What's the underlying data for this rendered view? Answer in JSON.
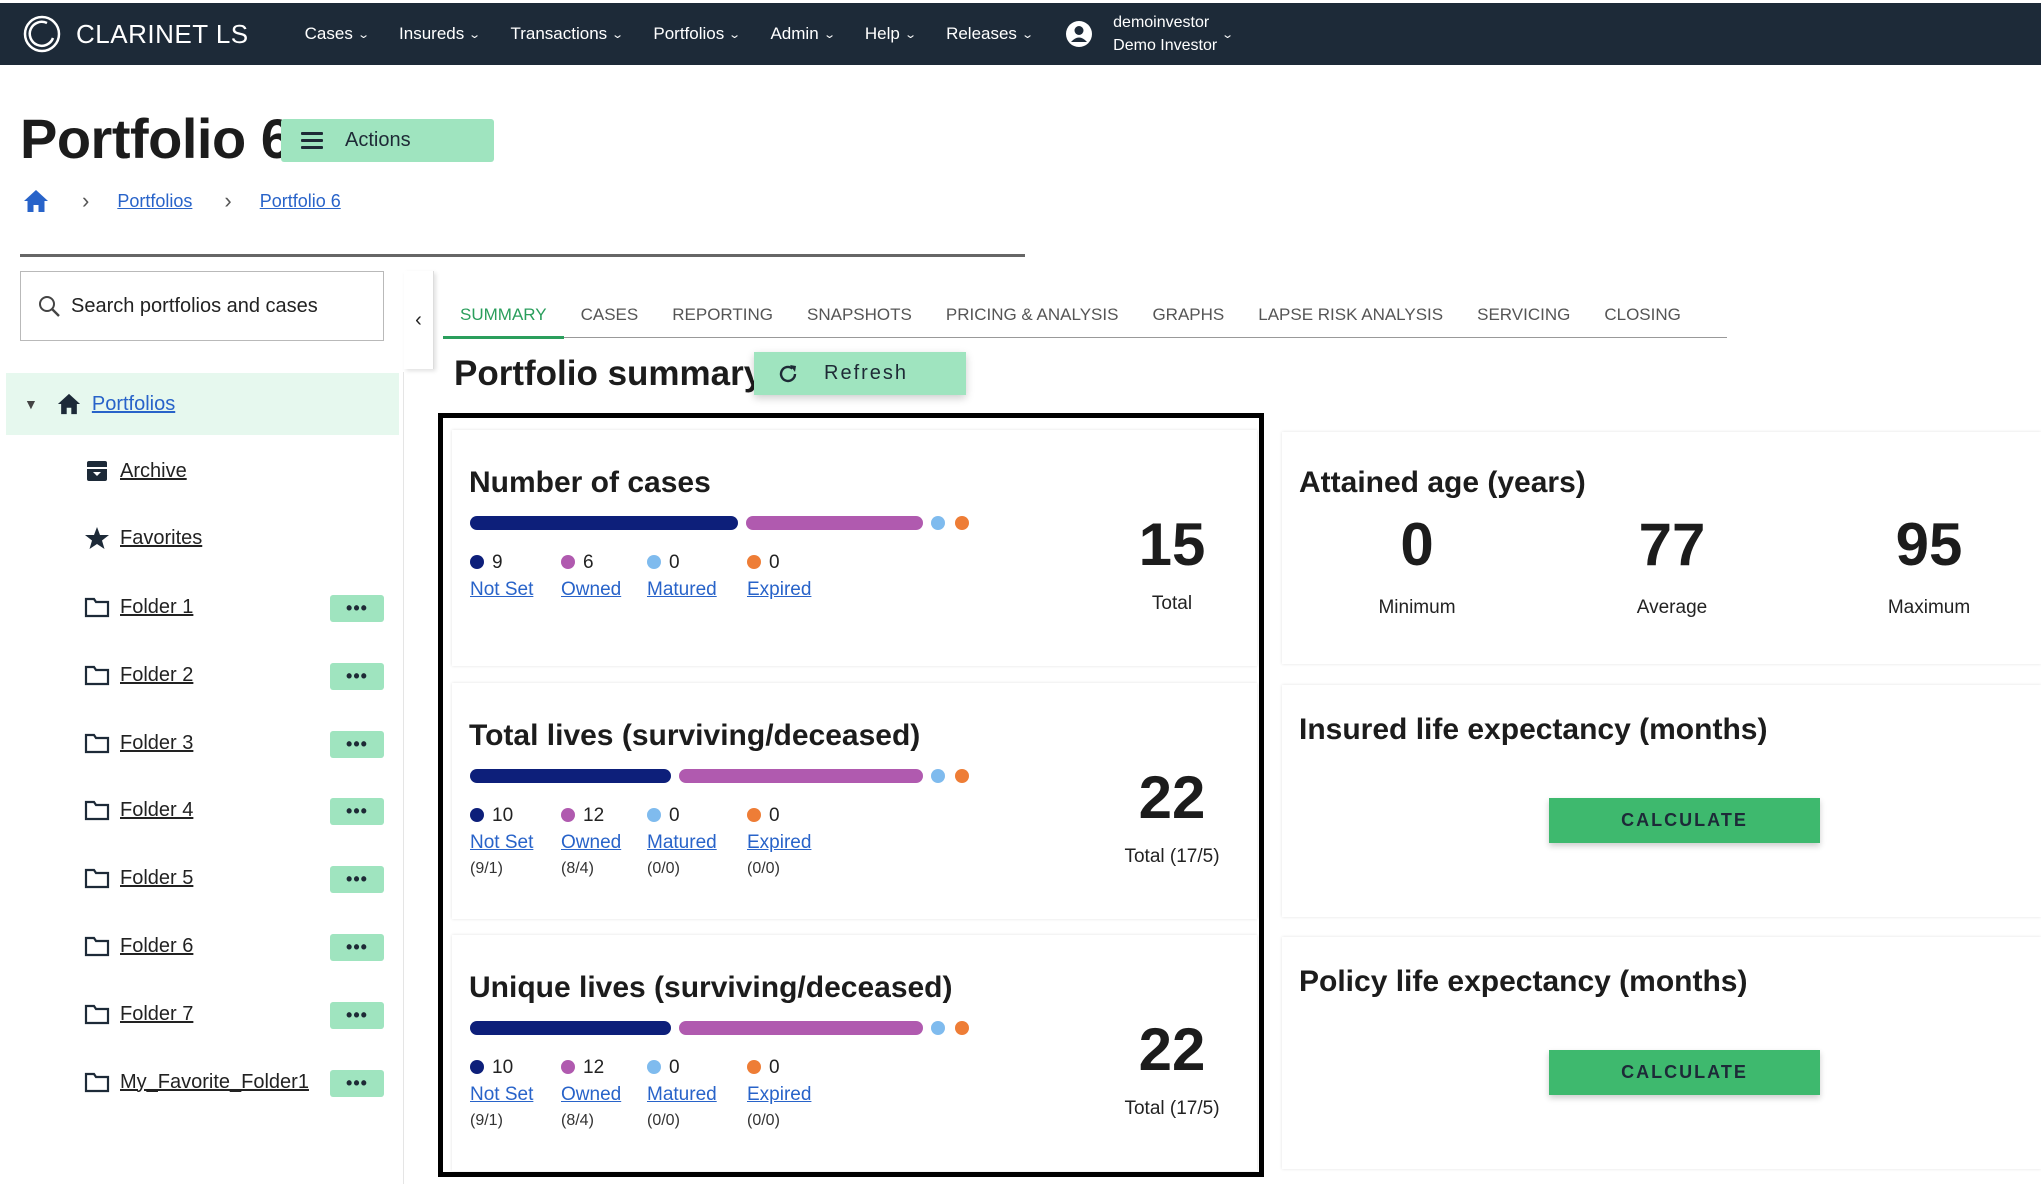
{
  "app": {
    "brand": "CLARINET LS"
  },
  "nav": {
    "items": [
      {
        "label": "Cases"
      },
      {
        "label": "Insureds"
      },
      {
        "label": "Transactions"
      },
      {
        "label": "Portfolios"
      },
      {
        "label": "Admin"
      },
      {
        "label": "Help"
      },
      {
        "label": "Releases"
      }
    ],
    "user": {
      "username": "demoinvestor",
      "display_name": "Demo Investor"
    }
  },
  "page": {
    "title": "Portfolio 6",
    "actions_label": "Actions"
  },
  "breadcrumb": {
    "items": [
      {
        "label": "Portfolios"
      },
      {
        "label": "Portfolio 6"
      }
    ]
  },
  "sidebar": {
    "search_placeholder": "Search portfolios and cases",
    "root": {
      "label": "Portfolios"
    },
    "items": [
      {
        "label": "Archive",
        "icon": "archive-icon"
      },
      {
        "label": "Favorites",
        "icon": "star-icon"
      },
      {
        "label": "Folder 1",
        "icon": "folder-icon",
        "more": "•••"
      },
      {
        "label": "Folder 2",
        "icon": "folder-icon",
        "more": "•••"
      },
      {
        "label": "Folder 3",
        "icon": "folder-icon",
        "more": "•••"
      },
      {
        "label": "Folder 4",
        "icon": "folder-icon",
        "more": "•••"
      },
      {
        "label": "Folder 5",
        "icon": "folder-icon",
        "more": "•••"
      },
      {
        "label": "Folder 6",
        "icon": "folder-icon",
        "more": "•••"
      },
      {
        "label": "Folder 7",
        "icon": "folder-icon",
        "more": "•••"
      },
      {
        "label": "My_Favorite_Folder1",
        "icon": "folder-icon",
        "more": "•••"
      }
    ]
  },
  "tabs": {
    "items": [
      {
        "label": "SUMMARY",
        "active": true
      },
      {
        "label": "CASES"
      },
      {
        "label": "REPORTING"
      },
      {
        "label": "SNAPSHOTS"
      },
      {
        "label": "PRICING & ANALYSIS"
      },
      {
        "label": "GRAPHS"
      },
      {
        "label": "LAPSE RISK ANALYSIS"
      },
      {
        "label": "SERVICING"
      },
      {
        "label": "CLOSING"
      }
    ]
  },
  "summary": {
    "title": "Portfolio summary",
    "refresh_label": "Refresh",
    "colors": {
      "not_set": "#0d1f7a",
      "owned": "#b05aaf",
      "matured": "#7fbbee",
      "expired": "#ee7d36"
    },
    "cases": {
      "title": "Number of cases",
      "legend": [
        {
          "count": "9",
          "label": "Not Set"
        },
        {
          "count": "6",
          "label": "Owned"
        },
        {
          "count": "0",
          "label": "Matured"
        },
        {
          "count": "0",
          "label": "Expired"
        }
      ],
      "total": "15",
      "total_label": "Total"
    },
    "total_lives": {
      "title": "Total lives (surviving/deceased)",
      "legend": [
        {
          "count": "10",
          "label": "Not Set",
          "sub": "(9/1)"
        },
        {
          "count": "12",
          "label": "Owned",
          "sub": "(8/4)"
        },
        {
          "count": "0",
          "label": "Matured",
          "sub": "(0/0)"
        },
        {
          "count": "0",
          "label": "Expired",
          "sub": "(0/0)"
        }
      ],
      "total": "22",
      "total_label": "Total (17/5)"
    },
    "unique_lives": {
      "title": "Unique lives (surviving/deceased)",
      "legend": [
        {
          "count": "10",
          "label": "Not Set",
          "sub": "(9/1)"
        },
        {
          "count": "12",
          "label": "Owned",
          "sub": "(8/4)"
        },
        {
          "count": "0",
          "label": "Matured",
          "sub": "(0/0)"
        },
        {
          "count": "0",
          "label": "Expired",
          "sub": "(0/0)"
        }
      ],
      "total": "22",
      "total_label": "Total (17/5)"
    },
    "attained_age": {
      "title": "Attained age (years)",
      "min": "0",
      "min_label": "Minimum",
      "avg": "77",
      "avg_label": "Average",
      "max": "95",
      "max_label": "Maximum"
    },
    "insured_le": {
      "title": "Insured life expectancy (months)",
      "button": "CALCULATE"
    },
    "policy_le": {
      "title": "Policy life expectancy (months)",
      "button": "CALCULATE"
    }
  }
}
